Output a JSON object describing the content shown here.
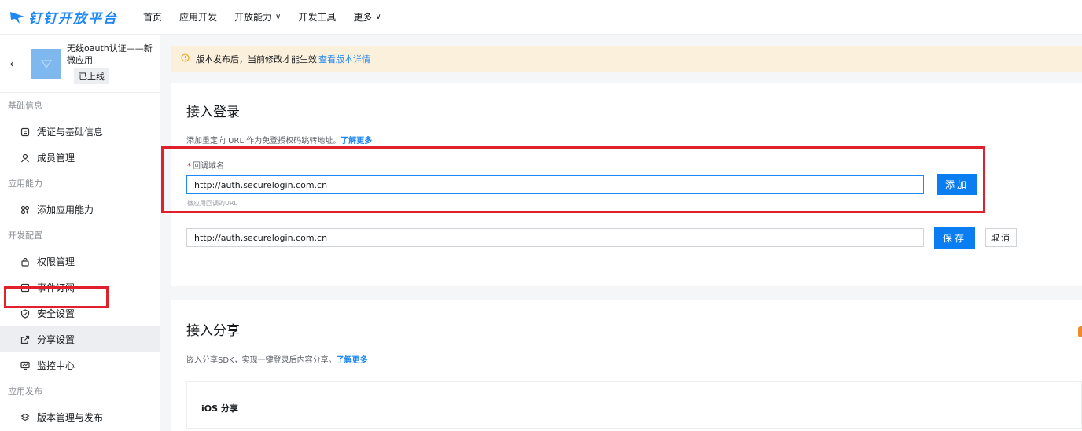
{
  "brand": {
    "name": "钉钉开放平台",
    "color": "#1e88f5"
  },
  "nav": [
    {
      "label": "首页",
      "has_dropdown": false
    },
    {
      "label": "应用开发",
      "has_dropdown": false
    },
    {
      "label": "开放能力",
      "has_dropdown": true
    },
    {
      "label": "开发工具",
      "has_dropdown": false
    },
    {
      "label": "更多",
      "has_dropdown": true
    }
  ],
  "app": {
    "name": "无线oauth认证——新微应用",
    "status": "已上线"
  },
  "sidebar": {
    "sections": [
      {
        "title": "基础信息",
        "items": [
          {
            "label": "凭证与基础信息",
            "icon": "credential-icon"
          },
          {
            "label": "成员管理",
            "icon": "user-icon"
          }
        ]
      },
      {
        "title": "应用能力",
        "items": [
          {
            "label": "添加应用能力",
            "icon": "capability-icon"
          }
        ]
      },
      {
        "title": "开发配置",
        "items": [
          {
            "label": "权限管理",
            "icon": "permission-icon"
          },
          {
            "label": "事件订阅",
            "icon": "event-icon"
          },
          {
            "label": "安全设置",
            "icon": "shield-icon"
          },
          {
            "label": "分享设置",
            "icon": "share-icon",
            "active": true
          },
          {
            "label": "监控中心",
            "icon": "monitor-icon"
          }
        ]
      },
      {
        "title": "应用发布",
        "items": [
          {
            "label": "版本管理与发布",
            "icon": "version-icon"
          }
        ]
      }
    ]
  },
  "notice": {
    "text": "版本发布后，当前修改才能生效",
    "link": "查看版本详情"
  },
  "login_card": {
    "title": "接入登录",
    "desc": "添加重定向 URL 作为免登授权码跳转地址。",
    "desc_link": "了解更多",
    "field_label": "回调域名",
    "required_mark": "*",
    "input_value": "http://auth.securelogin.com.cn",
    "hint": "微应用回调的URL",
    "add_button": "添加",
    "saved_value": "http://auth.securelogin.com.cn",
    "save_button": "保存",
    "cancel_button": "取消"
  },
  "share_card": {
    "title": "接入分享",
    "desc": "嵌入分享SDK，实现一键登录后内容分享。",
    "desc_link": "了解更多",
    "subcard_title": "iOS 分享"
  }
}
